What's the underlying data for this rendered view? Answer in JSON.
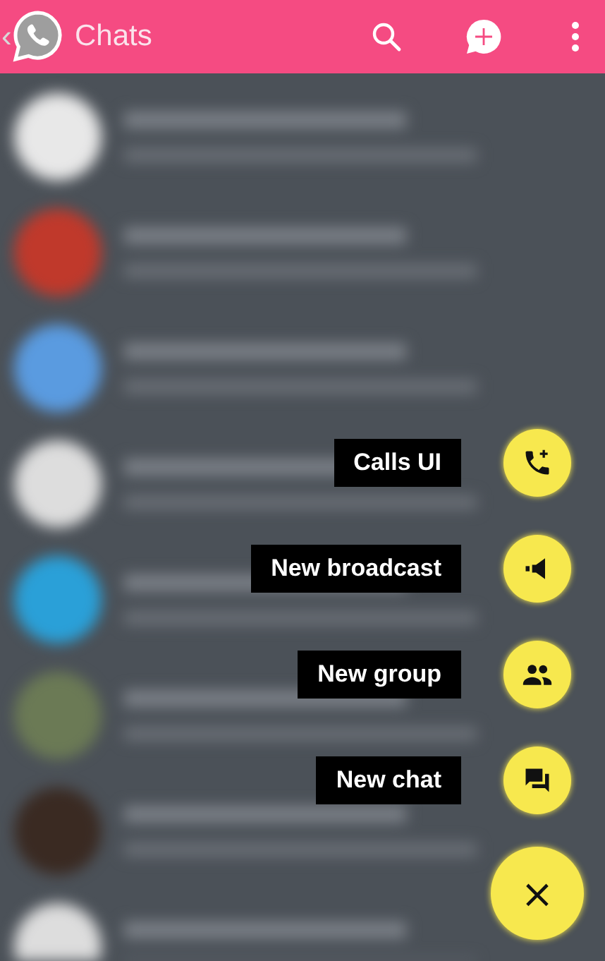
{
  "top_bar": {
    "back_glyph": "‹",
    "title": "Chats"
  },
  "actions": [
    {
      "kind": "call",
      "label": "Calls UI"
    },
    {
      "kind": "broadcast",
      "label": "New broadcast"
    },
    {
      "kind": "group",
      "label": "New group"
    },
    {
      "kind": "chat",
      "label": "New chat"
    }
  ],
  "close_button": {
    "glyph": "×"
  }
}
